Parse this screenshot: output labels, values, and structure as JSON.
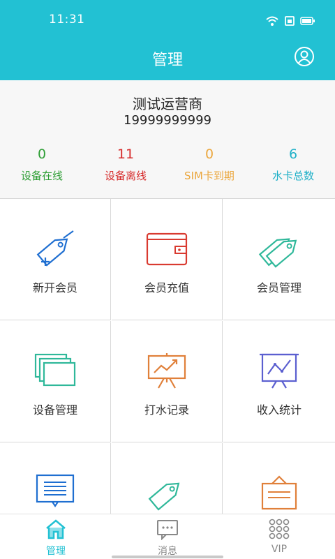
{
  "status_bar": {
    "time": "11:31"
  },
  "header": {
    "title": "管理"
  },
  "profile": {
    "name": "测试运营商",
    "phone": "19999999999"
  },
  "stats": [
    {
      "value": "0",
      "label": "设备在线",
      "color": "#2e9e35"
    },
    {
      "value": "11",
      "label": "设备离线",
      "color": "#d62b2b"
    },
    {
      "value": "0",
      "label": "SIM卡到期",
      "color": "#eba73e"
    },
    {
      "value": "6",
      "label": "水卡总数",
      "color": "#1fb0c8"
    }
  ],
  "grid": [
    {
      "label": "新开会员",
      "icon": "new-member-tag-icon"
    },
    {
      "label": "会员充值",
      "icon": "wallet-icon"
    },
    {
      "label": "会员管理",
      "icon": "member-tags-icon"
    },
    {
      "label": "设备管理",
      "icon": "stacked-devices-icon"
    },
    {
      "label": "打水记录",
      "icon": "chart-easel-icon"
    },
    {
      "label": "收入统计",
      "icon": "line-chart-board-icon"
    },
    {
      "label": "",
      "icon": "document-list-icon"
    },
    {
      "label": "",
      "icon": "tag-icon"
    },
    {
      "label": "",
      "icon": "hanging-sign-icon"
    }
  ],
  "tabbar": {
    "active_color": "#22c1d3",
    "tabs": [
      {
        "label": "管理",
        "icon": "home-icon",
        "active": true
      },
      {
        "label": "消息",
        "icon": "message-icon",
        "active": false
      },
      {
        "label": "VIP",
        "icon": "grid-dots-icon",
        "active": false
      }
    ]
  }
}
